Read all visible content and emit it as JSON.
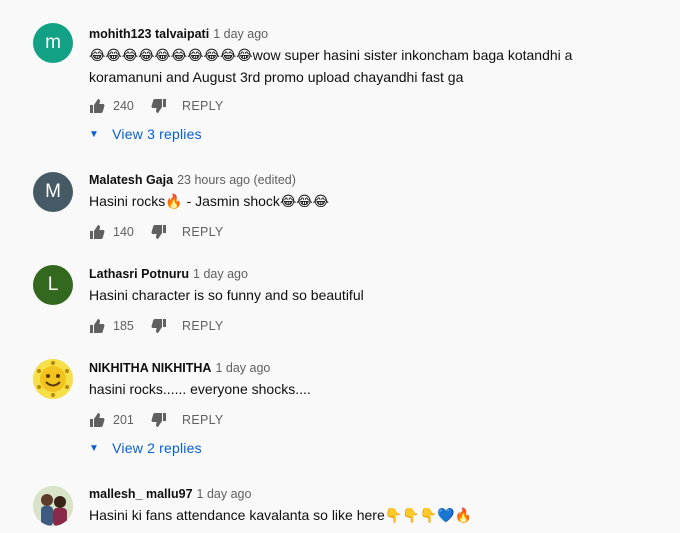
{
  "comments": [
    {
      "author": "mohith123 talvaipati",
      "time": "1 day ago",
      "avatar": {
        "letter": "m",
        "color": "#12a185"
      },
      "emoji_prefix": "😂😂😂😂😂😂😂😂😂😂",
      "text_part1": "wow super hasini sister inkoncham baga kotandhi a",
      "text_part2": "koramanuni and August 3rd promo upload chayandhi fast ga",
      "likes": "240",
      "reply_label": "REPLY",
      "view_replies": "View 3 replies"
    },
    {
      "author": "Malatesh Gaja",
      "time": "23 hours ago (edited)",
      "avatar": {
        "letter": "M",
        "color": "#455a64"
      },
      "text_a": "Hasini rocks",
      "emoji_a": "🔥",
      "text_b": " - Jasmin shock",
      "emoji_b": "😂😂😂",
      "likes": "140",
      "reply_label": "REPLY"
    },
    {
      "author": "Lathasri Potnuru",
      "time": "1 day ago",
      "avatar": {
        "letter": "L",
        "color": "#33691e"
      },
      "text": "Hasini character is so funny and so beautiful",
      "likes": "185",
      "reply_label": "REPLY"
    },
    {
      "author": "NIKHITHA NIKHITHA",
      "time": "1 day ago",
      "avatar": {
        "color": "#f2d53c"
      },
      "text": "hasini rocks...... everyone shocks....",
      "likes": "201",
      "reply_label": "REPLY",
      "view_replies": "View 2 replies"
    },
    {
      "author": "mallesh_ mallu97",
      "time": "1 day ago",
      "avatar": {
        "color": "#c9d8b0"
      },
      "text": "Hasini ki fans attendance kavalanta so like here",
      "emoji": "👇👇👇💙🔥"
    }
  ]
}
